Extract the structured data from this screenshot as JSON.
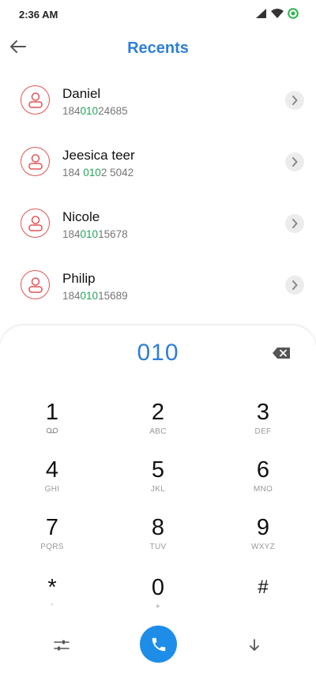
{
  "status_bar": {
    "time": "2:36 AM",
    "icons": [
      "signal-icon",
      "wifi-icon",
      "data-saver-icon"
    ]
  },
  "header": {
    "title": "Recents",
    "back_icon": "arrow-left-icon"
  },
  "contacts": [
    {
      "name": "Daniel",
      "number_pre": "184",
      "number_match": "010",
      "number_post": "24685"
    },
    {
      "name": "Jeesica teer",
      "number_pre": "184 ",
      "number_match": "010",
      "number_post": "2 5042"
    },
    {
      "name": "Nicole",
      "number_pre": "184",
      "number_match": "010",
      "number_post": "15678"
    },
    {
      "name": "Philip",
      "number_pre": "184",
      "number_match": "010",
      "number_post": "15689"
    }
  ],
  "dialpad": {
    "input": "010",
    "keys": [
      {
        "digit": "1",
        "letters": ""
      },
      {
        "digit": "2",
        "letters": "ABC"
      },
      {
        "digit": "3",
        "letters": "DEF"
      },
      {
        "digit": "4",
        "letters": "GHI"
      },
      {
        "digit": "5",
        "letters": "JKL"
      },
      {
        "digit": "6",
        "letters": "MNO"
      },
      {
        "digit": "7",
        "letters": "PQRS"
      },
      {
        "digit": "8",
        "letters": "TUV"
      },
      {
        "digit": "9",
        "letters": "WXYZ"
      },
      {
        "digit": "*",
        "letters": "'"
      },
      {
        "digit": "0",
        "letters": "+"
      },
      {
        "digit": "#",
        "letters": ""
      }
    ]
  },
  "colors": {
    "accent": "#2f7fd4",
    "match": "#23a55a",
    "avatar": "#e05555",
    "call": "#1e8de8"
  }
}
